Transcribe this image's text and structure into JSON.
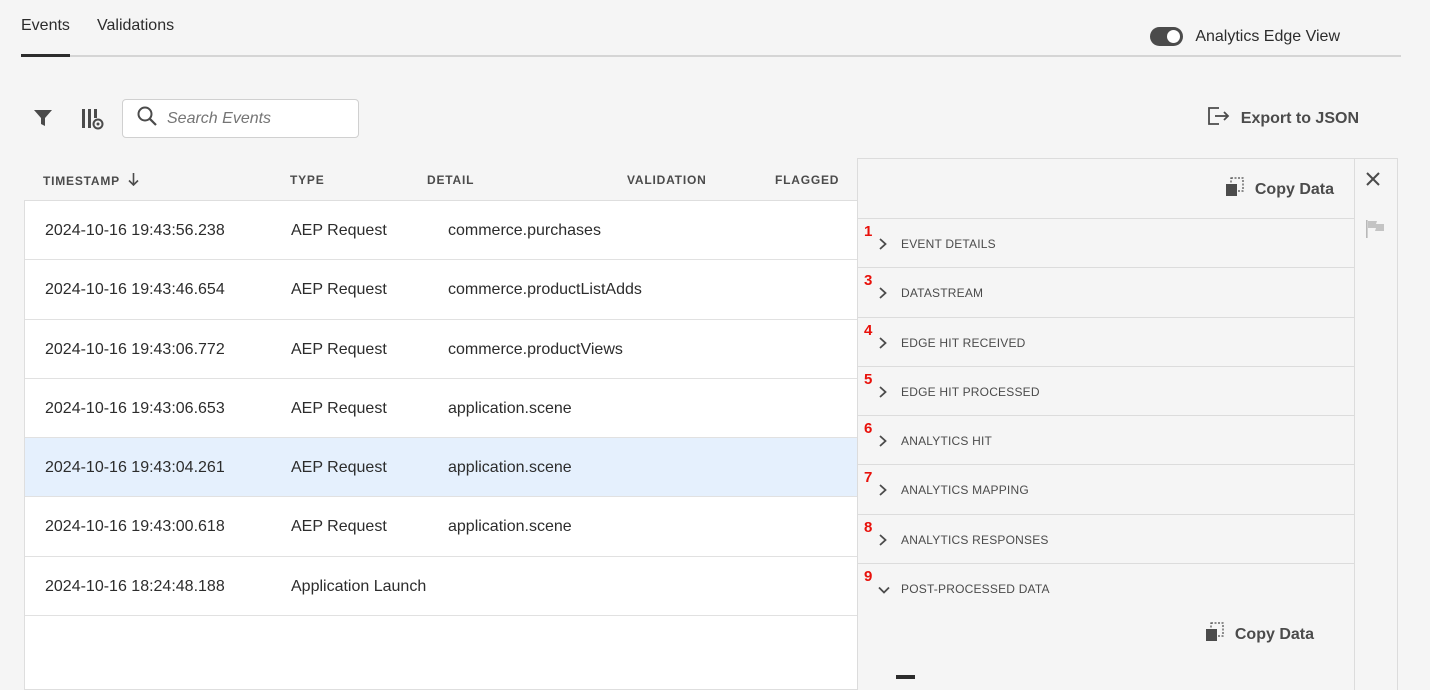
{
  "tabs": [
    {
      "label": "Events",
      "active": true
    },
    {
      "label": "Validations",
      "active": false
    }
  ],
  "toggle": {
    "label": "Analytics Edge View",
    "on": true
  },
  "search": {
    "placeholder": "Search Events"
  },
  "export": {
    "label": "Export to JSON"
  },
  "table": {
    "headers": {
      "timestamp": "TIMESTAMP",
      "type": "TYPE",
      "detail": "DETAIL",
      "validation": "VALIDATION",
      "flagged": "FLAGGED"
    },
    "rows": [
      {
        "timestamp": "2024-10-16 19:43:56.238",
        "type": "AEP Request",
        "detail": "commerce.purchases"
      },
      {
        "timestamp": "2024-10-16 19:43:46.654",
        "type": "AEP Request",
        "detail": "commerce.productListAdds"
      },
      {
        "timestamp": "2024-10-16 19:43:06.772",
        "type": "AEP Request",
        "detail": "commerce.productViews"
      },
      {
        "timestamp": "2024-10-16 19:43:06.653",
        "type": "AEP Request",
        "detail": "application.scene"
      },
      {
        "timestamp": "2024-10-16 19:43:04.261",
        "type": "AEP Request",
        "detail": "application.scene",
        "selected": true
      },
      {
        "timestamp": "2024-10-16 19:43:00.618",
        "type": "AEP Request",
        "detail": "application.scene"
      },
      {
        "timestamp": "2024-10-16 18:24:48.188",
        "type": "Application Launch",
        "detail": ""
      }
    ]
  },
  "panel": {
    "copy_label": "Copy Data",
    "sections": [
      {
        "num": "1",
        "label": "EVENT DETAILS",
        "expanded": false
      },
      {
        "num": "3",
        "label": "DATASTREAM",
        "expanded": false
      },
      {
        "num": "4",
        "label": "EDGE HIT RECEIVED",
        "expanded": false
      },
      {
        "num": "5",
        "label": "EDGE HIT PROCESSED",
        "expanded": false
      },
      {
        "num": "6",
        "label": "ANALYTICS HIT",
        "expanded": false
      },
      {
        "num": "7",
        "label": "ANALYTICS MAPPING",
        "expanded": false
      },
      {
        "num": "8",
        "label": "ANALYTICS RESPONSES",
        "expanded": false
      },
      {
        "num": "9",
        "label": "POST-PROCESSED DATA",
        "expanded": true
      }
    ]
  },
  "icons": [
    "filter-icon",
    "column-settings-icon",
    "search-icon",
    "export-icon",
    "copy-icon",
    "close-icon",
    "flag-icon",
    "chevron-right-icon",
    "chevron-down-icon",
    "sort-descending-icon"
  ],
  "colors": {
    "annotation": "#e8110b",
    "selected_row": "#e5f0fd",
    "toggle": "#4b4b4b"
  }
}
